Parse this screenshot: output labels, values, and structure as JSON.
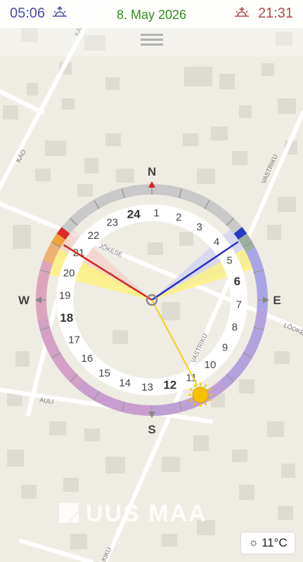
{
  "header": {
    "sunrise_time": "05:06",
    "date": "8. May 2026",
    "sunset_time": "21:31"
  },
  "compass": {
    "north": "N",
    "east": "E",
    "south": "S",
    "west": "W",
    "hours": [
      "1",
      "2",
      "3",
      "4",
      "5",
      "6",
      "7",
      "8",
      "9",
      "10",
      "11",
      "12",
      "13",
      "14",
      "15",
      "16",
      "17",
      "18",
      "19",
      "20",
      "21",
      "22",
      "23",
      "24"
    ]
  },
  "streets": [
    "KÄO",
    "KÄO",
    "JÕKESE",
    "VASTRIKU",
    "VASTRIKU",
    "LÕOKE",
    "AULI",
    "KIKU"
  ],
  "logo": "UUS MAA",
  "weather": {
    "temperature": "11°C",
    "icon": "sun-icon"
  },
  "colors": {
    "sunrise": "#4a4da8",
    "sunset": "#b24a4a",
    "date": "#3b8a22"
  }
}
